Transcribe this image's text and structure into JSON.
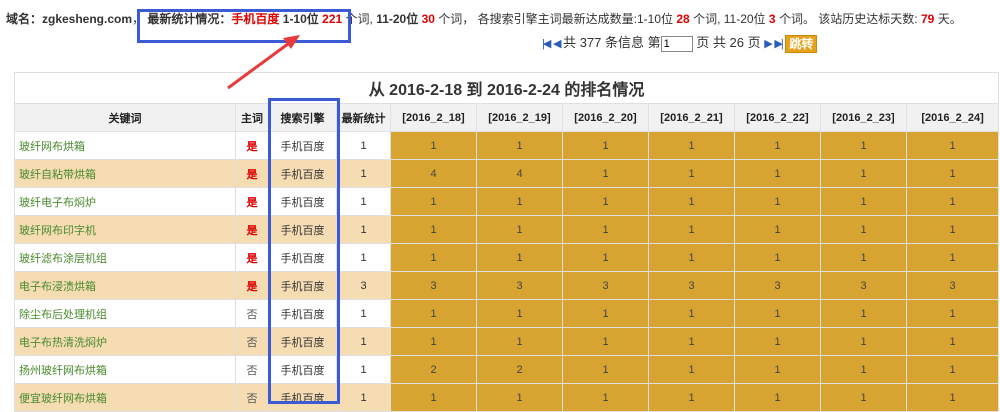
{
  "summary": {
    "domain_label": "域名：zgkesheng.com",
    "sep1": "，",
    "latest_label": "最新统计情况：",
    "engine": "手机百度",
    "r1_label": "1-10位",
    "r1_count": "221",
    "r1_unit": "个词,",
    "r2_label": "11-20位",
    "r2_count": "30",
    "r2_unit": "个词",
    "sep2": "，",
    "reach_label": "各搜索引擎主词最新达成数量:1-10位",
    "reach_r1": "28",
    "reach_r1_unit": "个词,",
    "reach_r2_label": "11-20位",
    "reach_r2": "3",
    "reach_r2_unit": "个词。",
    "days_label": "该站历史达标天数:",
    "days": "79",
    "days_unit": "天。"
  },
  "pager": {
    "first_icon": "first-page-icon",
    "prev_icon": "prev-page-icon",
    "total_prefix": "共",
    "total": "377",
    "total_suffix": "条信息",
    "page_prefix": "第",
    "current_page": "1",
    "page_mid": "页 共",
    "pages": "26",
    "page_suffix": "页",
    "next_icon": "next-page-icon",
    "last_icon": "last-page-icon",
    "go_label": "跳转"
  },
  "table": {
    "title": "从 2016-2-18 到 2016-2-24 的排名情况",
    "headers": [
      "关键词",
      "主词",
      "搜索引擎",
      "最新统计",
      "[2016_2_18]",
      "[2016_2_19]",
      "[2016_2_20]",
      "[2016_2_21]",
      "[2016_2_22]",
      "[2016_2_23]",
      "[2016_2_24]"
    ],
    "rows": [
      {
        "keyword": "玻纤网布烘箱",
        "main": "是",
        "engine": "手机百度",
        "latest": "1",
        "days": [
          "1",
          "1",
          "1",
          "1",
          "1",
          "1",
          "1"
        ]
      },
      {
        "keyword": "玻纤自粘带烘箱",
        "main": "是",
        "engine": "手机百度",
        "latest": "1",
        "days": [
          "4",
          "4",
          "1",
          "1",
          "1",
          "1",
          "1"
        ]
      },
      {
        "keyword": "玻纤电子布焖炉",
        "main": "是",
        "engine": "手机百度",
        "latest": "1",
        "days": [
          "1",
          "1",
          "1",
          "1",
          "1",
          "1",
          "1"
        ]
      },
      {
        "keyword": "玻纤网布印字机",
        "main": "是",
        "engine": "手机百度",
        "latest": "1",
        "days": [
          "1",
          "1",
          "1",
          "1",
          "1",
          "1",
          "1"
        ]
      },
      {
        "keyword": "玻纤滤布涂层机组",
        "main": "是",
        "engine": "手机百度",
        "latest": "1",
        "days": [
          "1",
          "1",
          "1",
          "1",
          "1",
          "1",
          "1"
        ]
      },
      {
        "keyword": "电子布浸渍烘箱",
        "main": "是",
        "engine": "手机百度",
        "latest": "3",
        "days": [
          "3",
          "3",
          "3",
          "3",
          "3",
          "3",
          "3"
        ]
      },
      {
        "keyword": "除尘布后处理机组",
        "main": "否",
        "engine": "手机百度",
        "latest": "1",
        "days": [
          "1",
          "1",
          "1",
          "1",
          "1",
          "1",
          "1"
        ]
      },
      {
        "keyword": "电子布热清洗焖炉",
        "main": "否",
        "engine": "手机百度",
        "latest": "1",
        "days": [
          "1",
          "1",
          "1",
          "1",
          "1",
          "1",
          "1"
        ]
      },
      {
        "keyword": "扬州玻纤网布烘箱",
        "main": "否",
        "engine": "手机百度",
        "latest": "1",
        "days": [
          "2",
          "2",
          "1",
          "1",
          "1",
          "1",
          "1"
        ]
      },
      {
        "keyword": "便宜玻纤网布烘箱",
        "main": "否",
        "engine": "手机百度",
        "latest": "1",
        "days": [
          "1",
          "1",
          "1",
          "1",
          "1",
          "1",
          "1"
        ]
      }
    ]
  },
  "colors": {
    "highlight": "#3b5ad6",
    "arrow": "#e83a3a",
    "gold_cell": "#d7a431",
    "alt_row": "#f5dcb3",
    "red_text": "#e00000",
    "keyword_green": "#4a8a2e"
  }
}
